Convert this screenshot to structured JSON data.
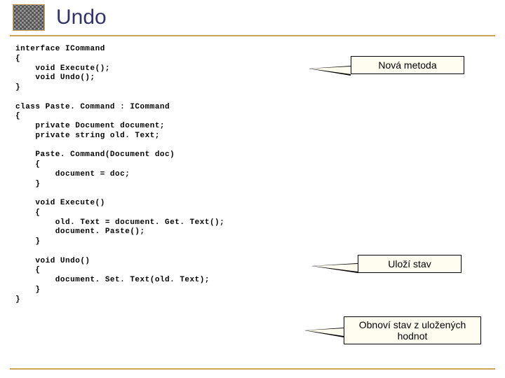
{
  "title": "Undo",
  "code": {
    "l0": "interface ICommand",
    "l1": "{",
    "l2": "    void Execute();",
    "l3": "    void Undo();",
    "l4": "}",
    "l5": "",
    "l6": "class Paste. Command : ICommand",
    "l7": "{",
    "l8": "    private Document document;",
    "l9": "    private string old. Text;",
    "l10": "",
    "l11": "    Paste. Command(Document doc)",
    "l12": "    {",
    "l13": "        document = doc;",
    "l14": "    }",
    "l15": "",
    "l16": "    void Execute()",
    "l17": "    {",
    "l18": "        old. Text = document. Get. Text();",
    "l19": "        document. Paste();",
    "l20": "    }",
    "l21": "",
    "l22": "    void Undo()",
    "l23": "    {",
    "l24": "        document. Set. Text(old. Text);",
    "l25": "    }",
    "l26": "}"
  },
  "callouts": {
    "c1": "Nová metoda",
    "c2": "Uloží stav",
    "c3": "Obnoví stav z uložených hodnot"
  }
}
